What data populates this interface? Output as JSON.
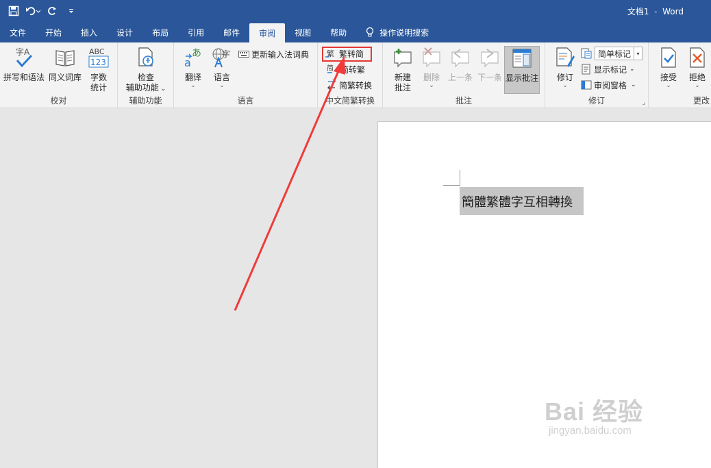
{
  "window": {
    "title": "文档1  -  Word"
  },
  "qat": {
    "save": "save-icon",
    "undo": "undo-icon",
    "redo": "redo-icon",
    "customize": "customize-icon"
  },
  "tabs": [
    {
      "label": "文件"
    },
    {
      "label": "开始"
    },
    {
      "label": "插入"
    },
    {
      "label": "设计"
    },
    {
      "label": "布局"
    },
    {
      "label": "引用"
    },
    {
      "label": "邮件"
    },
    {
      "label": "审阅",
      "active": true
    },
    {
      "label": "视图"
    },
    {
      "label": "帮助"
    }
  ],
  "tell_me": "操作说明搜索",
  "ribbon": {
    "proofing": {
      "label": "校对",
      "spelling": "拼写和语法",
      "thesaurus": "同义词库",
      "wordcount_line1": "字数",
      "wordcount_line2": "统计",
      "spelling_icon_text": "字A",
      "wordcount_icon_top": "ABC",
      "wordcount_icon_bottom": "123"
    },
    "accessibility": {
      "label": "辅助功能",
      "check_line1": "检查",
      "check_line2": "辅助功能"
    },
    "language": {
      "label": "语言",
      "translate": "翻译",
      "language": "语言",
      "update_ime": "更新输入法词典",
      "translate_icon_a": "あ",
      "translate_icon_b": "a",
      "language_icon": "字"
    },
    "chinese_conversion": {
      "label": "中文简繁转换",
      "to_simplified": "繁转简",
      "to_traditional": "简转繁",
      "convert": "简繁转换",
      "to_simplified_icon": "繁",
      "to_traditional_icon": "简"
    },
    "comments": {
      "label": "批注",
      "new_line1": "新建",
      "new_line2": "批注",
      "delete": "删除",
      "previous": "上一条",
      "next": "下一条",
      "show": "显示批注"
    },
    "tracking": {
      "label": "修订",
      "track": "修订",
      "markup_value": "简单标记",
      "show_markup": "显示标记",
      "review_pane": "审阅窗格"
    },
    "changes": {
      "label": "更改",
      "accept": "接受",
      "reject": "拒绝"
    }
  },
  "document": {
    "selected_text": "簡體繁體字互相轉換"
  },
  "watermark": {
    "main": "Bai 经验",
    "sub": "jingyan.baidu.com"
  },
  "colors": {
    "title_bar": "#2b579a",
    "ribbon": "#f3f3f3",
    "highlight": "#e53935",
    "selection": "#c6c6c6"
  }
}
